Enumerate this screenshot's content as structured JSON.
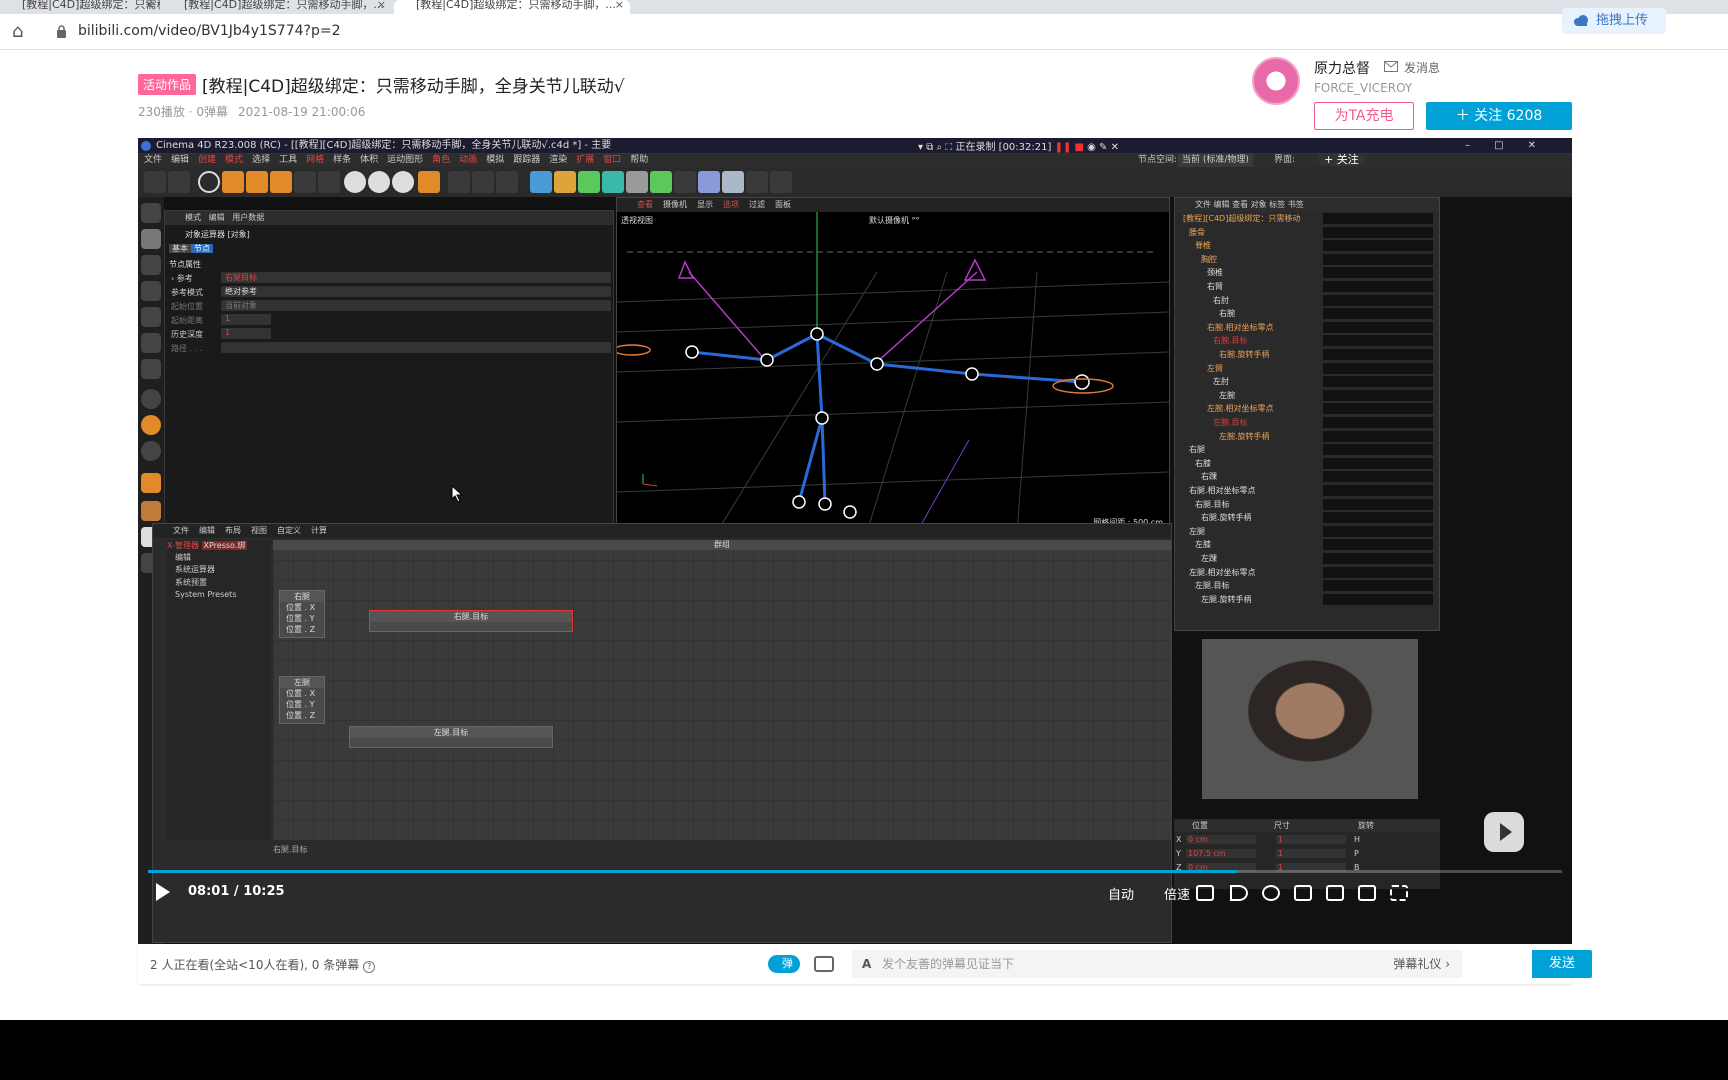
{
  "browser": {
    "tabs": [
      {
        "label": "[教程|C4D]超级绑定：只需移动手脚，..."
      },
      {
        "label": "[教程|C4D]超级绑定：只需移动手脚，..."
      }
    ],
    "url": "bilibili.com/video/BV1Jb4y1S774?p=2",
    "upload_label": "拖拽上传"
  },
  "video": {
    "event_tag": "活动作品",
    "title": "[教程|C4D]超级绑定：只需移动手脚，全身关节儿联动√",
    "plays": "230播放 · 0弹幕",
    "date": "2021-08-19 21:00:06"
  },
  "uploader": {
    "name": "原力总督",
    "message_label": "发消息",
    "desc": "FORCE_VICEROY",
    "charge_label": "为TA充电",
    "follow_label": "＋ 关注 6208"
  },
  "c4d": {
    "window_title": "Cinema 4D R23.008 (RC) - [[教程][C4D]超级绑定：只需移动手脚，全身关节儿联动√.c4d *] - 主要",
    "recording": "正在录制 [00:32:21]",
    "menu": [
      "文件",
      "编辑",
      "创建",
      "模式",
      "选择",
      "工具",
      "网格",
      "样条",
      "体积",
      "运动图形",
      "角色",
      "动画",
      "模拟",
      "跟踪器",
      "渲染",
      "扩展",
      "窗口",
      "帮助"
    ],
    "attr_menu": [
      "模式",
      "编辑",
      "用户数据"
    ],
    "attr_title": "对象运算器 [对象]",
    "attr_tabs": [
      "基本",
      "节点"
    ],
    "attr_section": "节点属性",
    "attr_rows": [
      {
        "label": "› 参考",
        "value": "右腿目标"
      },
      {
        "label": "参考模式",
        "value": "绝对参考"
      },
      {
        "label": "起始位置",
        "value": "当前对象"
      },
      {
        "label": "起始距离",
        "value": "1"
      },
      {
        "label": "历史深度",
        "value": "1"
      },
      {
        "label": "路径 . . .",
        "value": ""
      }
    ],
    "viewport_menu": [
      "查看",
      "摄像机",
      "显示",
      "选项",
      "过滤",
      "面板"
    ],
    "viewport_label": "透视视图",
    "camera_label": "默认摄像机 °°",
    "grid_label": "网格间距 : 500 cm",
    "objects": [
      {
        "name": "[教程][C4D]超级绑定：只需移动",
        "color": "o"
      },
      {
        "name": "腰骨",
        "color": "o"
      },
      {
        "name": "脊椎",
        "color": "o"
      },
      {
        "name": "胸腔",
        "color": "o"
      },
      {
        "name": "颈椎",
        "color": "w"
      },
      {
        "name": "右臂",
        "color": "w"
      },
      {
        "name": "右肘",
        "color": "w"
      },
      {
        "name": "右腕",
        "color": "w"
      },
      {
        "name": "右腕.相对坐标零点",
        "color": "o"
      },
      {
        "name": "右腕.目标",
        "color": "r"
      },
      {
        "name": "右腕.旋转手柄",
        "color": "o"
      },
      {
        "name": "左臂",
        "color": "o"
      },
      {
        "name": "左肘",
        "color": "w"
      },
      {
        "name": "左腕",
        "color": "w"
      },
      {
        "name": "左腕.相对坐标零点",
        "color": "o"
      },
      {
        "name": "左腕.目标",
        "color": "r"
      },
      {
        "name": "左腕.旋转手柄",
        "color": "o"
      },
      {
        "name": "右腿",
        "color": "w"
      },
      {
        "name": "右膝",
        "color": "w"
      },
      {
        "name": "右踝",
        "color": "w"
      },
      {
        "name": "右腿.相对坐标零点",
        "color": "w"
      },
      {
        "name": "右腿.目标",
        "color": "w"
      },
      {
        "name": "右腿.旋转手柄",
        "color": "w"
      },
      {
        "name": "左腿",
        "color": "w"
      },
      {
        "name": "左膝",
        "color": "w"
      },
      {
        "name": "左踝",
        "color": "w"
      },
      {
        "name": "左腿.相对坐标零点",
        "color": "w"
      },
      {
        "name": "左腿.目标",
        "color": "w"
      },
      {
        "name": "左腿.旋转手柄",
        "color": "w"
      }
    ],
    "xp_menu": [
      "文件",
      "编辑",
      "布局",
      "视图",
      "自定义",
      "计算"
    ],
    "xp_tabs": [
      "X-管理器",
      "XPresso.绑"
    ],
    "xp_tree": [
      "编辑",
      "系统运算器",
      "系统预置",
      "System Presets"
    ],
    "xp_title": "群组",
    "nodes": [
      {
        "title": "右腿",
        "ports": [
          "位置 . X",
          "位置 . Y",
          "位置 . Z"
        ]
      },
      {
        "title": "左腿",
        "ports": [
          "位置 . X",
          "位置 . Y",
          "位置 . Z"
        ]
      },
      {
        "title": "右腿.目标",
        "ports": []
      },
      {
        "title": "左腿.目标",
        "ports": []
      }
    ],
    "status": "右腿.目标",
    "coords_head": [
      "位置",
      "尺寸",
      "旋转"
    ],
    "coords": [
      {
        "axis": "X",
        "pos": "0 cm",
        "size": "1",
        "rot": "H"
      },
      {
        "axis": "Y",
        "pos": "107.5 cm",
        "size": "1",
        "rot": "P"
      },
      {
        "axis": "Z",
        "pos": "0 cm",
        "size": "1",
        "rot": "B"
      }
    ],
    "node_space": "节点空间:",
    "node_space_value": "当前 (标准/物理)",
    "interface_label": "界面:",
    "follow_overlay": "+ 关注"
  },
  "player": {
    "time_current": "08:01",
    "time_total": "10:25",
    "progress": 0.77,
    "auto_label": "自动",
    "speed_label": "倍速"
  },
  "danmaku": {
    "viewers": "2 人正在看(全站<10人在看), 0 条弹幕",
    "toggle_label": "弹",
    "placeholder": "发个友善的弹幕见证当下",
    "etiquette": "弹幕礼仪 ›",
    "send_label": "发送"
  },
  "colors": {
    "bili_blue": "#00a1d6",
    "bili_pink": "#f25d8e",
    "c4d_red": "#e23b3b",
    "c4d_orange": "#e8a25a"
  }
}
